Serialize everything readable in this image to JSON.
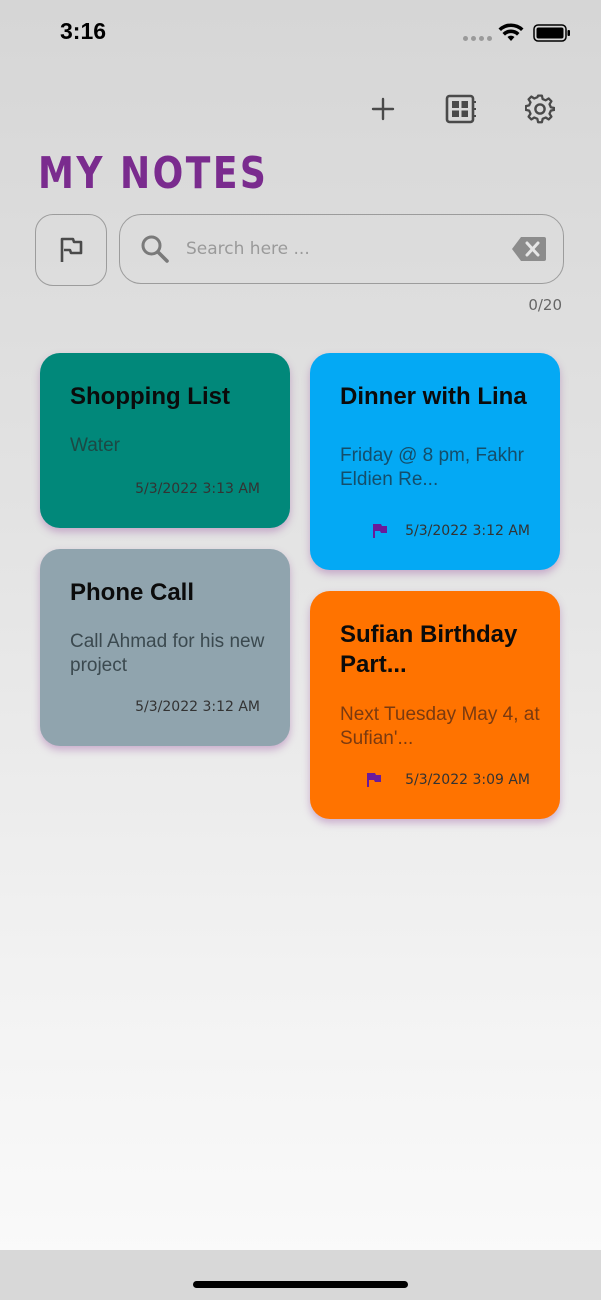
{
  "status_bar": {
    "time": "3:16"
  },
  "toolbar": {
    "add_icon": "plus-icon",
    "view_icon": "grid-view-icon",
    "settings_icon": "gear-icon"
  },
  "header": {
    "title": "MY NOTES",
    "title_color": "#7a2b8e"
  },
  "search": {
    "placeholder": "Search here ...",
    "value": "",
    "counter": "0/20"
  },
  "notes": [
    {
      "title": "Shopping List",
      "body": "Water",
      "date": "5/3/2022 3:13 AM",
      "flagged": false,
      "color": "#01887a"
    },
    {
      "title": "Dinner with Lina",
      "body": "Friday @ 8 pm, Fakhr Eldien Re...",
      "date": "5/3/2022 3:12 AM",
      "flagged": true,
      "color": "#04a9f4"
    },
    {
      "title": "Phone Call",
      "body": "Call Ahmad for his new project",
      "date": "5/3/2022 3:12 AM",
      "flagged": false,
      "color": "#90a4ae"
    },
    {
      "title": "Sufian Birthday Part...",
      "body": "Next Tuesday May 4, at Sufian'...",
      "date": "5/3/2022 3:09 AM",
      "flagged": true,
      "color": "#ff7300"
    }
  ]
}
